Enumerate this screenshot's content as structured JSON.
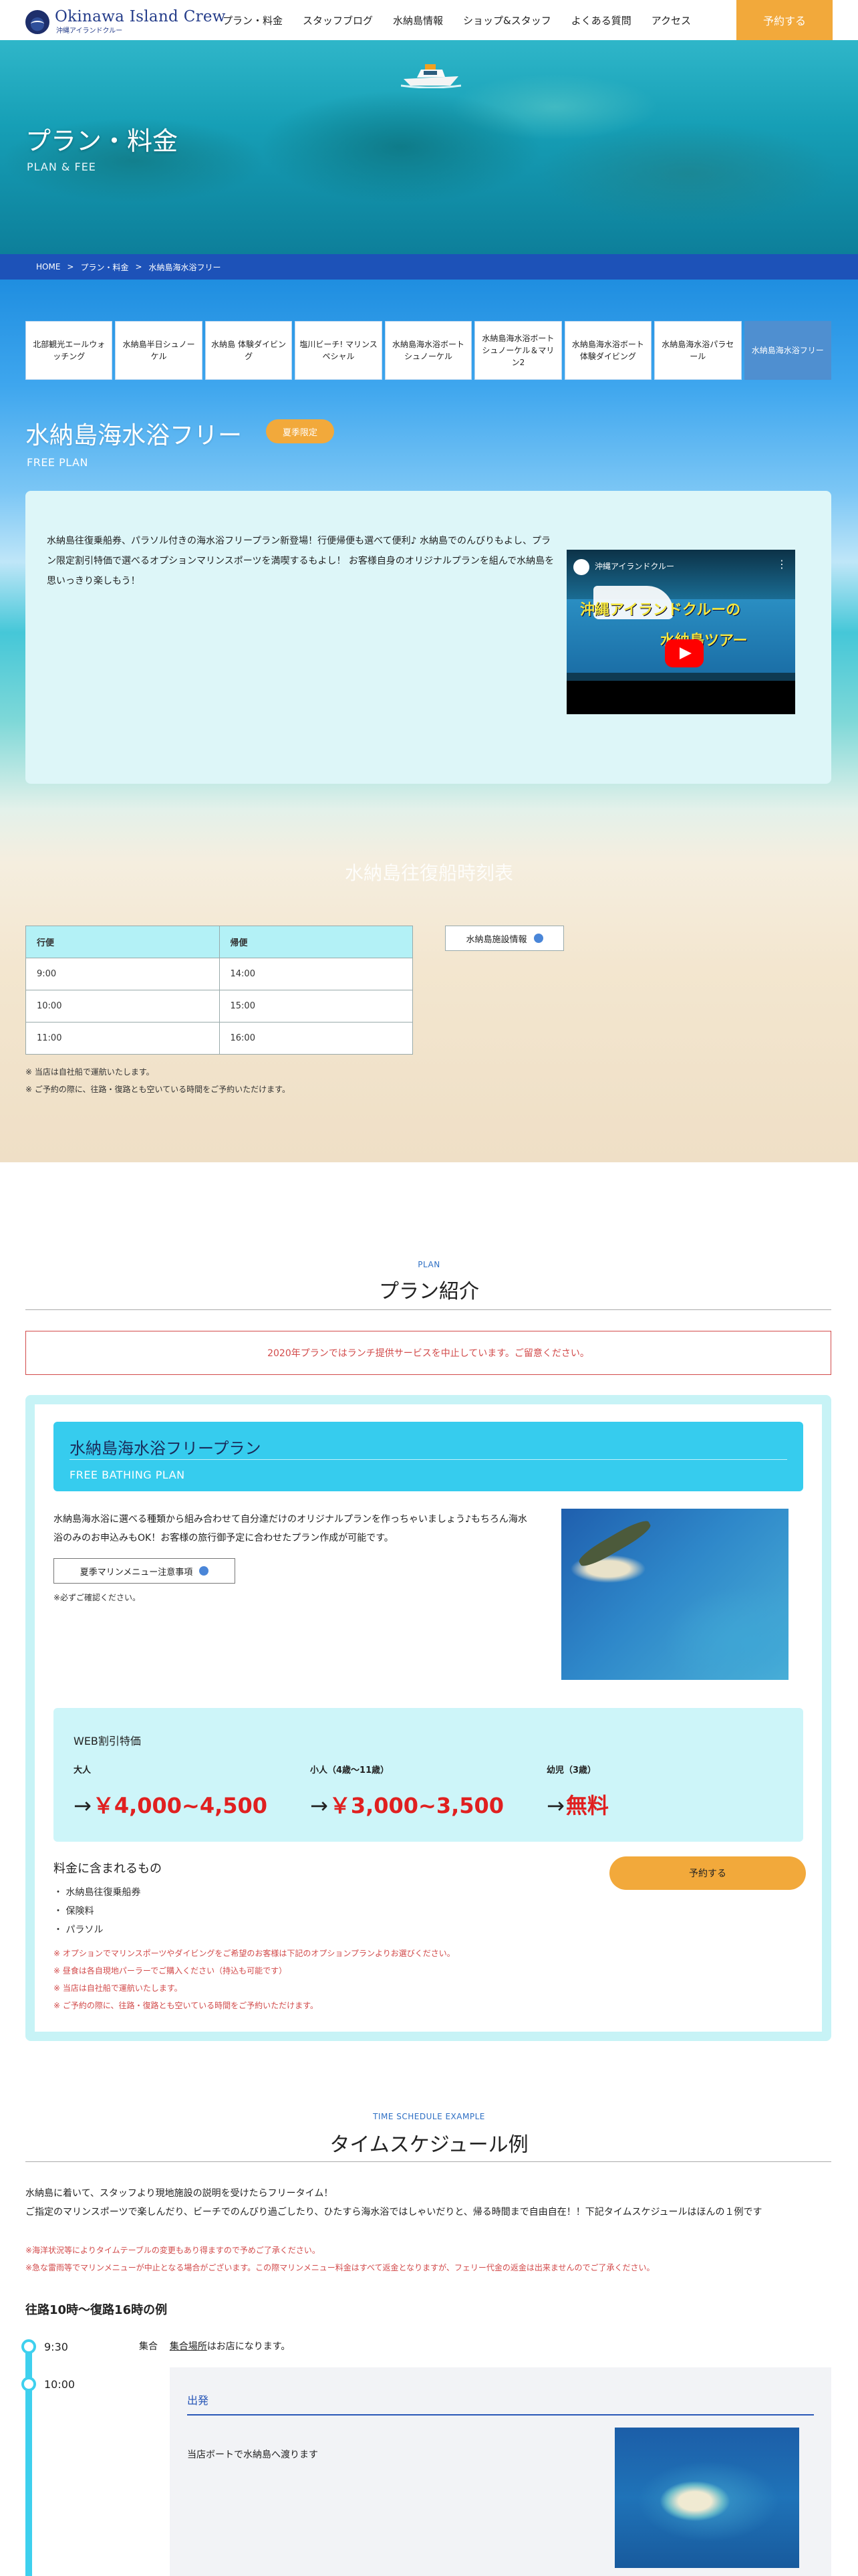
{
  "header": {
    "logo_title": "Okinawa Island Crew",
    "logo_sub": "沖縄アイランドクルー",
    "nav": [
      "プラン・料金",
      "スタッフブログ",
      "水納島情報",
      "ショップ&スタッフ",
      "よくある質問",
      "アクセス"
    ],
    "reserve_label": "予約する"
  },
  "hero": {
    "title": "プラン・料金",
    "subtitle": "PLAN & FEE"
  },
  "breadcrumb": [
    "HOME",
    "プラン・料金",
    "水納島海水浴フリー"
  ],
  "tabs": [
    {
      "label": "北部観光エールウォッチング"
    },
    {
      "label": "水納島半日シュノーケル"
    },
    {
      "label": "水納島 体験ダイビング"
    },
    {
      "label": "塩川ビーチ! マリンスペシャル"
    },
    {
      "label": "水納島海水浴ボートシュノーケル"
    },
    {
      "label": "水納島海水浴ボートシュノーケル＆マリン2"
    },
    {
      "label": "水納島海水浴ボート体験ダイビング"
    },
    {
      "label": "水納島海水浴パラセール"
    },
    {
      "label": "水納島海水浴フリー"
    }
  ],
  "plan": {
    "title": "水納島海水浴フリー",
    "badge": "夏季限定",
    "subtitle": "FREE PLAN",
    "intro": "水納島往復乗船券、パラソル付きの海水浴フリープラン新登場！行便帰便も選べて便利♪ 水納島でのんびりもよし、プラン限定割引特価で選べるオプションマリンスポーツを満喫するもよし！ お客様自身のオリジナルプランを組んで水納島を思いっきり楽しもう！"
  },
  "video": {
    "channel": "沖縄アイランドクルー",
    "caption1": "沖縄アイランドクルーの",
    "caption2": "水納島ツアー"
  },
  "ferry": {
    "heading": "水納島往復船時刻表",
    "headers": [
      "行便",
      "帰便"
    ],
    "rows": [
      [
        "9:00",
        "14:00"
      ],
      [
        "10:00",
        "15:00"
      ],
      [
        "11:00",
        "16:00"
      ]
    ],
    "facility_button": "水納島施設情報",
    "notes": [
      "※ 当店は自社船で運航いたします。",
      "※ ご予約の際に、往路・復路とも空いている時間をご予約いただけます。"
    ]
  },
  "plan_section": {
    "tag": "PLAN",
    "title": "プラン紹介",
    "notice": "2020年プランではランチ提供サービスを中止しています。ご留意ください。"
  },
  "card": {
    "title": "水納島海水浴フリープラン",
    "subtitle": "FREE BATHING PLAN",
    "desc": "水納島海水浴に選べる種類から組み合わせて自分達だけのオリジナルプランを作っちゃいましょう♪もちろん海水浴のみのお申込みもOK！お客様の旅行御予定に合わせたプラン作成が可能です。",
    "marine_button": "夏季マリンメニュー注意事項",
    "check_note": "※必ずご確認ください。",
    "price_heading": "WEB割引特価",
    "prices": [
      {
        "label": "大人",
        "value": "￥4,000~4,500"
      },
      {
        "label": "小人（4歳〜11歳）",
        "value": "￥3,000~3,500"
      },
      {
        "label": "幼児（3歳）",
        "value": "無料"
      }
    ],
    "arrow": "→",
    "included_title": "料金に含まれるもの",
    "included": [
      "・ 水納島往復乗船券",
      "・ 保険料",
      "・ パラソル"
    ],
    "book_button": "予約する",
    "red_notes": [
      "※ オプションでマリンスポーツやダイビングをご希望のお客様は下記のオプションプランよりお選びください。",
      "※ 昼食は各自現地パーラーでご購入ください（持込も可能です）",
      "※ 当店は自社船で運航いたします。",
      "※ ご予約の際に、往路・復路とも空いている時間をご予約いただけます。"
    ]
  },
  "schedule": {
    "tag": "TIME SCHEDULE EXAMPLE",
    "title": "タイムスケジュール例",
    "intro1": "水納島に着いて、スタッフより現地施設の説明を受けたらフリータイム！",
    "intro2": "ご指定のマリンスポーツで楽しんだり、ビーチでのんびり過ごしたり、ひたすら海水浴ではしゃいだりと、帰る時間まで自由自在！！下記タイムスケジュールはほんの１例です",
    "red1": "※海洋状況等によりタイムテーブルの変更もあり得ますので予めご了承ください。",
    "red2": "※急な雷雨等でマリンメニューが中止となる場合がございます。この際マリンメニュー料金はすべて返金となりますが、フェリー代金の返金は出来ませんのでご了承ください。",
    "route": "往路10時〜復路16時の例",
    "times": [
      "9:30",
      "10:00"
    ],
    "gather_label": "集合",
    "gather_link": "集合場所",
    "gather_rest": "はお店になります。",
    "depart_title": "出発",
    "depart_text": "当店ボートで水納島へ渡ります"
  }
}
